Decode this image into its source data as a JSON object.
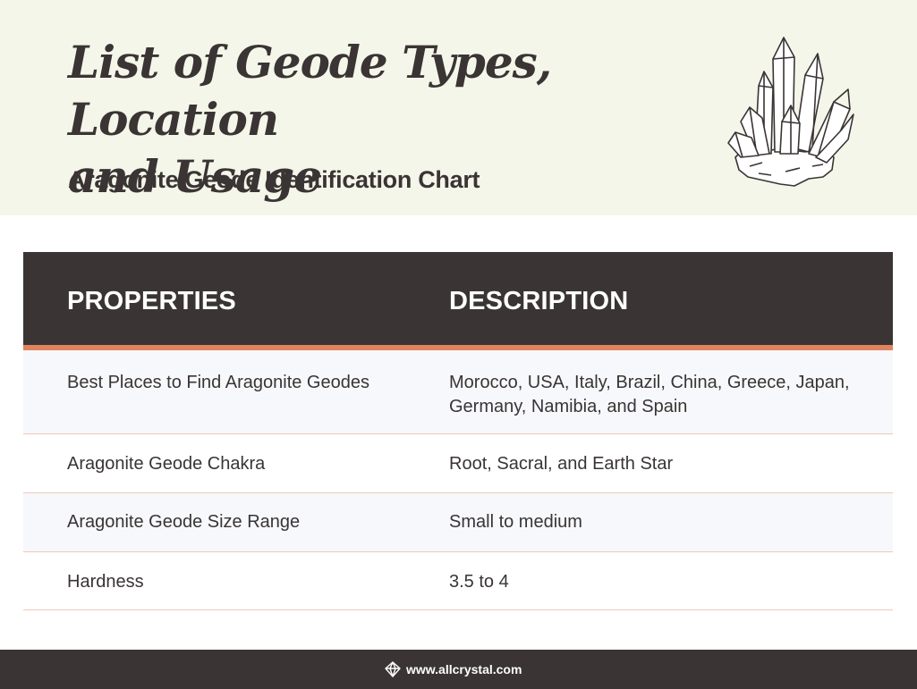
{
  "header": {
    "title_line1": "List of Geode Types, Location",
    "title_line2": "and Usage",
    "subtitle": "Aragonite Geode Identification Chart",
    "illustration_icon": "crystal-cluster-icon"
  },
  "table": {
    "columns": [
      "PROPERTIES",
      "DESCRIPTION"
    ],
    "rows": [
      {
        "property": "Best Places to Find Aragonite Geodes",
        "description_line1": "Morocco, USA, Italy, Brazil, China, Greece, Japan,",
        "description_line2": "Germany, Namibia, and Spain"
      },
      {
        "property": "Aragonite Geode Chakra",
        "description_line1": "Root, Sacral, and Earth Star"
      },
      {
        "property": "Aragonite Geode Size Range",
        "description_line1": "Small to medium"
      },
      {
        "property": "Hardness",
        "description_line1": "3.5 to 4"
      }
    ]
  },
  "footer": {
    "icon": "crystal-logo-icon",
    "website": "www.allcrystal.com"
  },
  "colors": {
    "header_bg": "#f5f6ea",
    "dark": "#3a3434",
    "accent": "#e0835f",
    "row_alt": "#f6f8fb",
    "row_divider": "#efc8b8"
  }
}
